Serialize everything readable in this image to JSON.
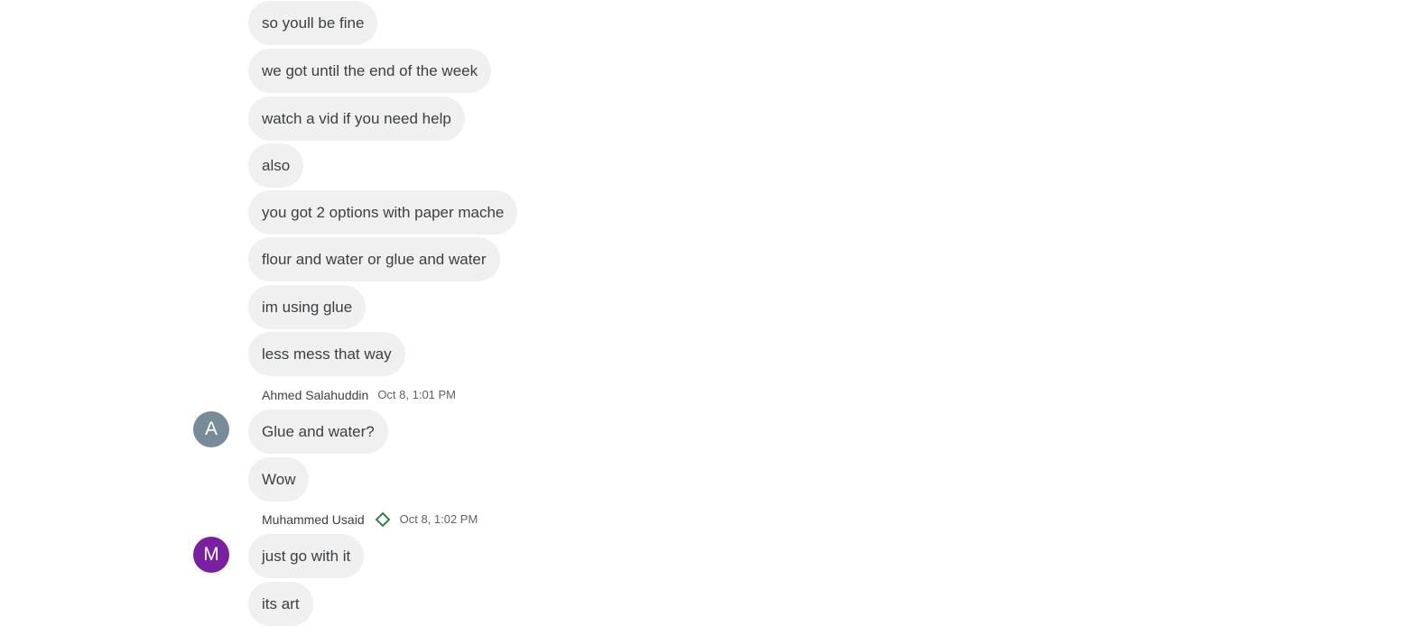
{
  "messages_block_1": [
    "so youll be fine",
    "we got until the end of the week",
    "watch a vid if you need help",
    "also",
    "you got 2 options with paper mache",
    "flour and water or glue and water",
    "im using glue",
    "less mess that way"
  ],
  "group_ahmed": {
    "name": "Ahmed Salahuddin",
    "time": "Oct 8, 1:01 PM",
    "avatar_letter": "A",
    "avatar_color": "#778b98",
    "messages": [
      "Glue and water?",
      "Wow"
    ]
  },
  "group_muhammed": {
    "name": "Muhammed Usaid",
    "time": "Oct 8, 1:02 PM",
    "avatar_letter": "M",
    "avatar_color": "#7b1fa2",
    "owner_icon": "diamond-outline-icon",
    "owner_icon_color": "#3a7d44",
    "messages": [
      "just go with it",
      "its art"
    ]
  }
}
